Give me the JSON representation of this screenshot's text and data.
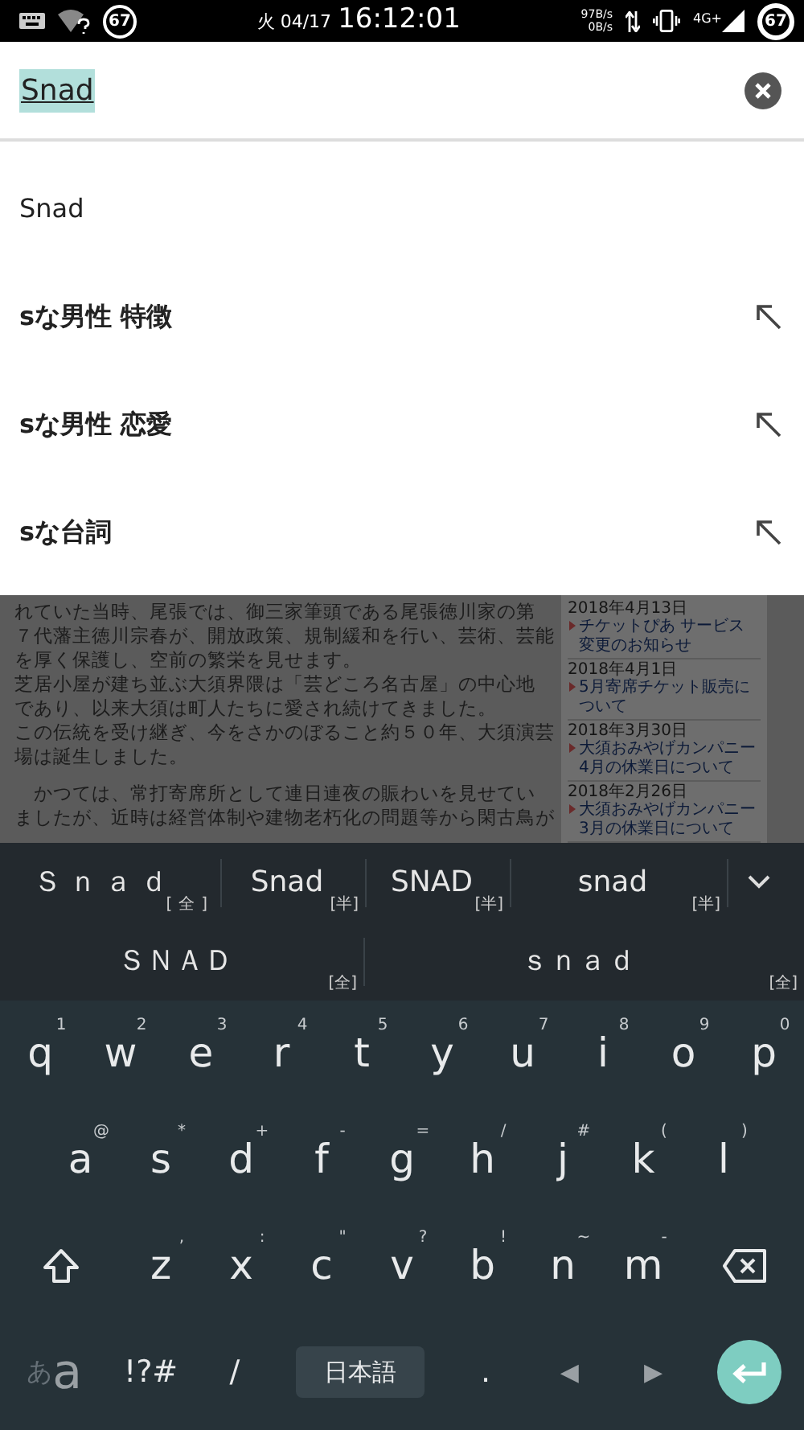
{
  "status_bar": {
    "notification_count": "67",
    "date": "火 04/17",
    "time": "16:12:01",
    "upload_speed": "97B/s",
    "download_speed": "0B/s",
    "network": "4G+",
    "battery": "67"
  },
  "search": {
    "value": "Snad"
  },
  "suggestions": [
    {
      "kind": "query",
      "text": "Snad"
    },
    {
      "kind": "completion",
      "text": "sな男性 特徴"
    },
    {
      "kind": "completion",
      "text": "sな男性 恋愛"
    },
    {
      "kind": "completion",
      "text": "sな台詞"
    }
  ],
  "background_page": {
    "paragraphs": [
      [
        "れていた当時、尾張では、御三家筆頭である尾張徳川家の第",
        "７代藩主徳川宗春が、開放政策、規制緩和を行い、芸術、芸能",
        "を厚く保護し、空前の繁栄を見せます。",
        "芝居小屋が建ち並ぶ大須界隈は「芸どころ名古屋」の中心地",
        "であり、以来大須は町人たちに愛され続けてきました。",
        "この伝統を受け継ぎ、今をさかのぼること約５０年、大須演芸",
        "場は誕生しました。"
      ],
      [
        "　かつては、常打寄席所として連日連夜の賑わいを見せてい",
        "ましたが、近時は経営体制や建物老朽化の問題等から閑古鳥が"
      ]
    ],
    "news": [
      {
        "date": "2018年4月13日",
        "title": "チケットぴあ サービス変更のお知らせ"
      },
      {
        "date": "2018年4月1日",
        "title": "5月寄席チケット販売について"
      },
      {
        "date": "2018年3月30日",
        "title": "大須おみやげカンパニー 4月の休業日について"
      },
      {
        "date": "2018年2月26日",
        "title": "大須おみやげカンパニー 3月の休業日について"
      }
    ]
  },
  "candidates": [
    [
      {
        "text": "Ｓｎａｄ",
        "tag": "[全]"
      },
      {
        "text": "Snad",
        "tag": "[半]"
      },
      {
        "text": "SNAD",
        "tag": "[半]"
      },
      {
        "text": "snad",
        "tag": "[半]"
      }
    ],
    [
      {
        "text": "ＳＮＡＤ",
        "tag": "[全]"
      },
      {
        "text": "ｓｎａｄ",
        "tag": "[全]"
      }
    ]
  ],
  "keyboard": [
    [
      {
        "kind": "letter",
        "label": "q",
        "hint": "1"
      },
      {
        "kind": "letter",
        "label": "w",
        "hint": "2"
      },
      {
        "kind": "letter",
        "label": "e",
        "hint": "3"
      },
      {
        "kind": "letter",
        "label": "r",
        "hint": "4"
      },
      {
        "kind": "letter",
        "label": "t",
        "hint": "5"
      },
      {
        "kind": "letter",
        "label": "y",
        "hint": "6"
      },
      {
        "kind": "letter",
        "label": "u",
        "hint": "7"
      },
      {
        "kind": "letter",
        "label": "i",
        "hint": "8"
      },
      {
        "kind": "letter",
        "label": "o",
        "hint": "9"
      },
      {
        "kind": "letter",
        "label": "p",
        "hint": "0"
      }
    ],
    [
      {
        "kind": "letter",
        "label": "a",
        "hint": "@"
      },
      {
        "kind": "letter",
        "label": "s",
        "hint": "*"
      },
      {
        "kind": "letter",
        "label": "d",
        "hint": "+"
      },
      {
        "kind": "letter",
        "label": "f",
        "hint": "-"
      },
      {
        "kind": "letter",
        "label": "g",
        "hint": "="
      },
      {
        "kind": "letter",
        "label": "h",
        "hint": "/"
      },
      {
        "kind": "letter",
        "label": "j",
        "hint": "#"
      },
      {
        "kind": "letter",
        "label": "k",
        "hint": "("
      },
      {
        "kind": "letter",
        "label": "l",
        "hint": ")"
      }
    ],
    [
      {
        "kind": "shift"
      },
      {
        "kind": "letter",
        "label": "z",
        "hint": ","
      },
      {
        "kind": "letter",
        "label": "x",
        "hint": ":"
      },
      {
        "kind": "letter",
        "label": "c",
        "hint": "\""
      },
      {
        "kind": "letter",
        "label": "v",
        "hint": "?"
      },
      {
        "kind": "letter",
        "label": "b",
        "hint": "!"
      },
      {
        "kind": "letter",
        "label": "n",
        "hint": "~"
      },
      {
        "kind": "letter",
        "label": "m",
        "hint": "-"
      },
      {
        "kind": "backspace"
      }
    ],
    [
      {
        "kind": "mode",
        "label": "あ",
        "hint": "a"
      },
      {
        "kind": "symbol",
        "label": "!?#"
      },
      {
        "kind": "symbol",
        "label": "/"
      },
      {
        "kind": "space",
        "label": "日本語"
      },
      {
        "kind": "symbol",
        "label": "."
      },
      {
        "kind": "arrow",
        "label": "◀"
      },
      {
        "kind": "arrow",
        "label": "▶"
      },
      {
        "kind": "enter"
      }
    ]
  ]
}
